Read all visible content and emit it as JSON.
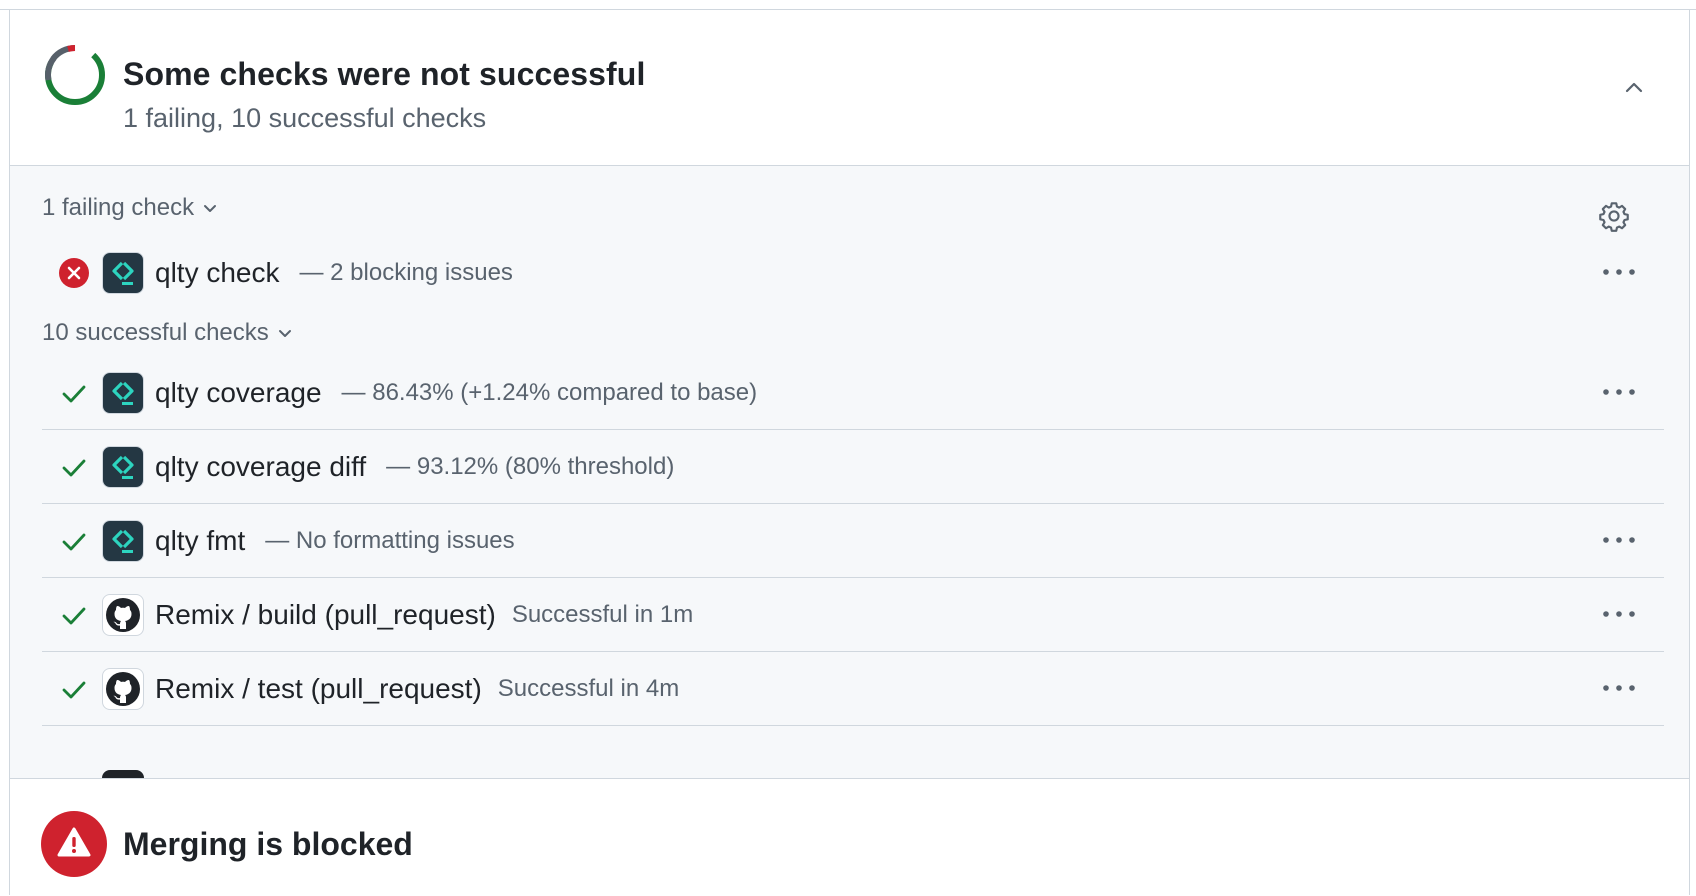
{
  "header": {
    "title": "Some checks were not successful",
    "subtitle": "1 failing, 10 successful checks"
  },
  "failing_section": {
    "label": "1 failing check",
    "checks": [
      {
        "name": "qlty check",
        "description": "— 2 blocking issues",
        "status": "failure",
        "app": "qlty",
        "has_menu": true
      }
    ]
  },
  "successful_section": {
    "label": "10 successful checks",
    "checks": [
      {
        "name": "qlty coverage",
        "description": "— 86.43% (+1.24% compared to base)",
        "status": "success",
        "app": "qlty",
        "has_menu": true
      },
      {
        "name": "qlty coverage diff",
        "description": "— 93.12% (80% threshold)",
        "status": "success",
        "app": "qlty",
        "has_menu": false
      },
      {
        "name": "qlty fmt",
        "description": "— No formatting issues",
        "status": "success",
        "app": "qlty",
        "has_menu": true
      },
      {
        "name": "Remix / build (pull_request)",
        "description": "Successful in 1m",
        "status": "success",
        "app": "github",
        "has_menu": true
      },
      {
        "name": "Remix / test (pull_request)",
        "description": "Successful in 4m",
        "status": "success",
        "app": "github",
        "has_menu": true
      }
    ]
  },
  "footer": {
    "title": "Merging is blocked"
  },
  "colors": {
    "success": "#1a7f37",
    "failure": "#cf222e",
    "muted": "#59636e",
    "qlty_bg": "#243743",
    "qlty_accent": "#2dd4bf",
    "list_bg": "#f6f8fa",
    "border": "#d0d7de"
  },
  "icons": {
    "status_ring": "partial-failure-ring-icon",
    "collapse": "chevron-up-icon",
    "section_toggle": "chevron-down-icon",
    "settings": "gear-icon",
    "failure": "x-circle-fill-icon",
    "success": "check-icon",
    "qlty_app": "qlty-logo-icon",
    "github_app": "github-mark-icon",
    "menu": "kebab-horizontal-icon",
    "footer": "alert-fill-icon"
  }
}
